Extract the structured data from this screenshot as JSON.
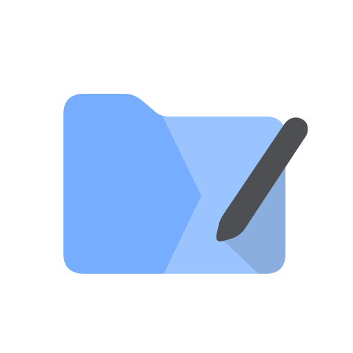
{
  "icon": {
    "name": "folder-edit-icon",
    "colors": {
      "folder_back": "#76adff",
      "folder_front": "#9ac4ff",
      "folder_shadow": "#8aafdf",
      "pen": "#4e4f52"
    }
  }
}
